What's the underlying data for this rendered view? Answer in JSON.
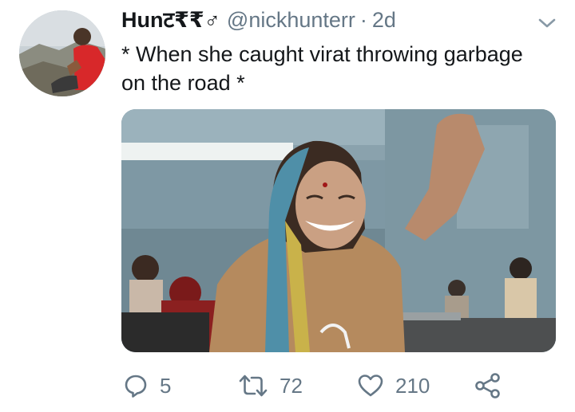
{
  "tweet": {
    "display_name": "Hunट₹₹♂",
    "handle": "@nickhunterr",
    "separator": "·",
    "time": "2d",
    "text": "* When she caught virat throwing garbage on the road *",
    "avatar_icon": "profile-photo",
    "media_icon": "photo-woman-cheering-in-sewing-workshop"
  },
  "actions": {
    "reply_count": "5",
    "retweet_count": "72",
    "like_count": "210",
    "icons": [
      "reply-icon",
      "retweet-icon",
      "heart-icon",
      "share-icon"
    ]
  },
  "colors": {
    "text_primary": "#14171a",
    "text_secondary": "#657786",
    "background": "#ffffff"
  }
}
